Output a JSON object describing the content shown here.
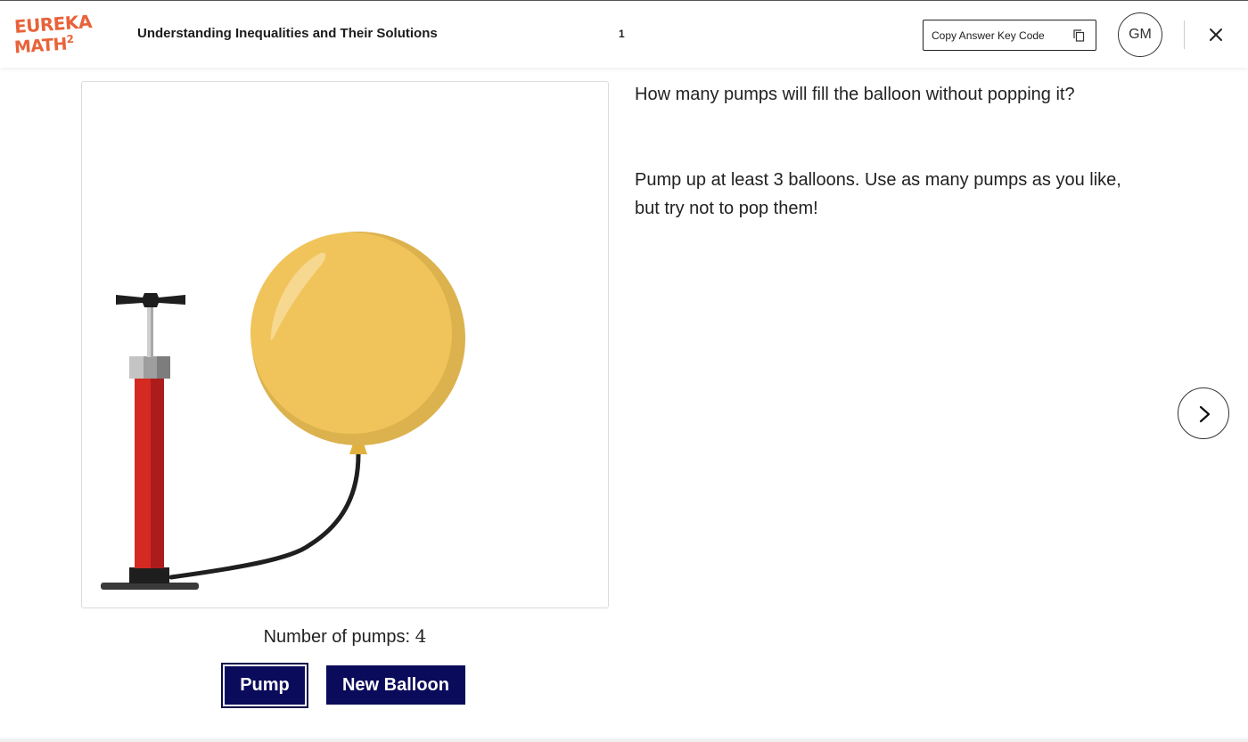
{
  "header": {
    "logo_line1": "EUREKA",
    "logo_line2": "MATH",
    "logo_sup": "2",
    "lesson_title": "Understanding Inequalities and Their Solutions",
    "page_number": "1",
    "copy_button_label": "Copy Answer Key Code",
    "avatar_initials": "GM"
  },
  "main": {
    "question": "How many pumps will fill the balloon without popping it?",
    "instructions_line1": "Pump up at least 3 balloons. Use as many pumps as you like,",
    "instructions_line2": "but try not to pop them!",
    "pump_count_label": "Number of pumps:",
    "pump_count_value": "4",
    "pump_button_label": "Pump",
    "new_balloon_button_label": "New Balloon"
  },
  "icons": {
    "copy": "copy-icon",
    "close": "close-icon",
    "next": "chevron-right-icon"
  },
  "colors": {
    "brand_orange": "#e8633a",
    "button_navy": "#0b0b5c",
    "balloon_yellow": "#f0c45a",
    "pump_red": "#d42a22"
  }
}
